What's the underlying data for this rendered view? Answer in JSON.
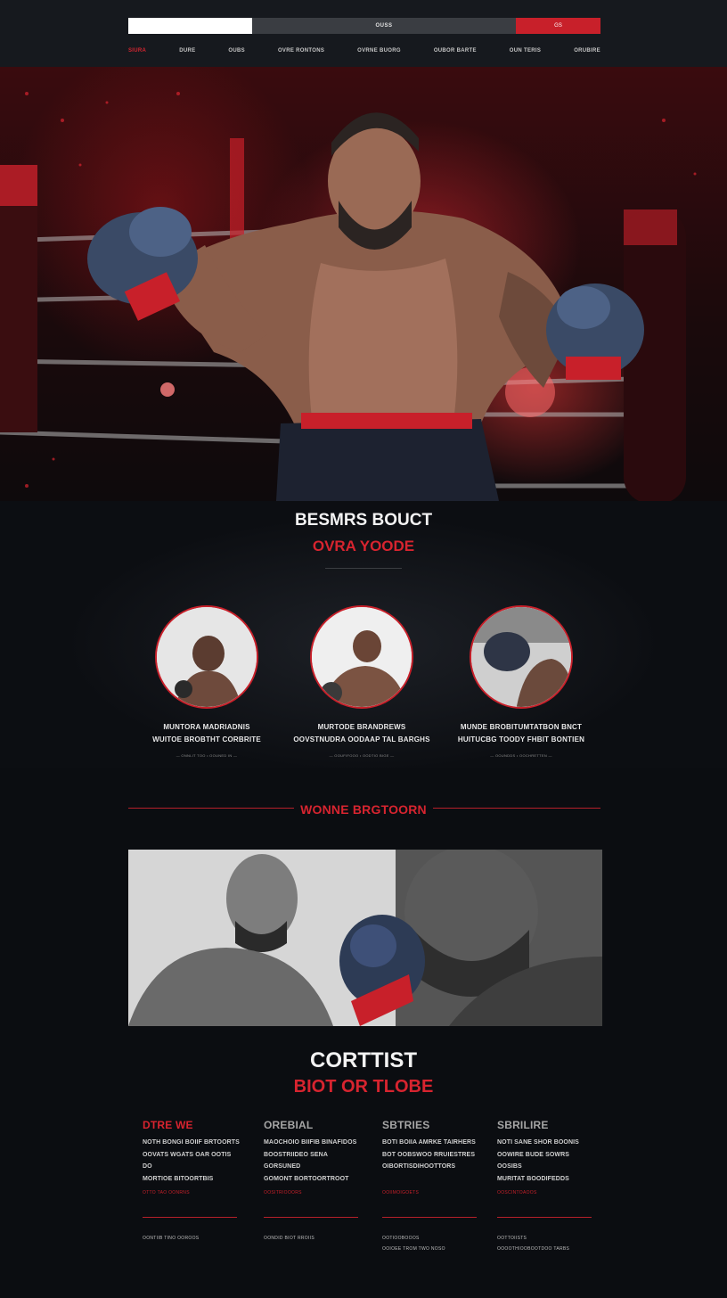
{
  "header": {
    "search_center_text": "OUSS",
    "search_button_label": "GS",
    "nav": [
      "SIURA",
      "DURE",
      "OUBS",
      "OVRE RONTONS",
      "OVRNE BUORG",
      "OUBOR BARTE",
      "OUN TERIS",
      "ORUBIRE"
    ]
  },
  "about": {
    "title": "BESMRS BOUCT",
    "subtitle": "OVRA YOODE",
    "cards": [
      {
        "line1": "MUNTORA MADRIADNIS",
        "line2": "WUITOE BROBTHT CORBRITE",
        "meta": "— ONNLIT TOO  •  OOUNED IN —"
      },
      {
        "line1": "MURTODE BRANDREWS",
        "line2": "OOVSTNUDRA OODAAP TAL BARGHS",
        "meta": "— OOUFIFOOO  •  OODTIO BIGE —"
      },
      {
        "line1": "MUNDE BROBITUMTATBON BNCT",
        "line2": "HUITUCBG TOODY FHBIT BONTIEN",
        "meta": "— OOUNDDS  •  OOCHRETTEN —"
      }
    ]
  },
  "divider_title": "WONNE BRGTOORN",
  "contact": {
    "title": "CORTTIST",
    "subtitle": "BIOT OR TLOBE",
    "columns": [
      {
        "title": "DTRE WE",
        "accent": "red",
        "lines": [
          "NOTH BONGI BOIIF BRTOORTS",
          "OOVATS WGATS OAR OOTIS DO",
          "MORTIOE BITOORTBIS"
        ],
        "link": "OTTO TAO OONRNS",
        "foot": [
          "OONTIIB TINO OOROOS"
        ]
      },
      {
        "title": "OREBIAL",
        "accent": "grey",
        "lines": [
          "MAOCHOIO BIIFIB BINAFIDOS",
          "BOOSTRIIDEO SENA GORSUNED",
          "GOMONT BORTOORTROOT"
        ],
        "link": "OOSITRIOOORS",
        "foot": [
          "OONDID BIOT RROIIS"
        ]
      },
      {
        "title": "SBTRIES",
        "accent": "grey",
        "lines": [
          "BOTI BOIIA AMRKE TAIRHERS",
          "BOT OOBSWOO RRUIESTRES",
          "OIBORTISDIHOOTTORS"
        ],
        "link": "OOIIMOIGOETS",
        "foot": [
          "OOTIOOBOOOS",
          "OOIOEE TROM TWO NOSO"
        ]
      },
      {
        "title": "SBRILIRE",
        "accent": "grey",
        "lines": [
          "NOTI SANE SHOR BOONIS",
          "OOWIRE BUDE SOWRS OOSIBS",
          "MURITAT BOODIFEDDS"
        ],
        "link": "OOSCINTOAOOS",
        "foot": [
          "OOTTOIISTS",
          "OOOOTHIOOBOOTDOO TARBS"
        ]
      }
    ]
  },
  "colors": {
    "accent": "#d7242f",
    "background": "#0b0d11",
    "header": "#16191e"
  }
}
